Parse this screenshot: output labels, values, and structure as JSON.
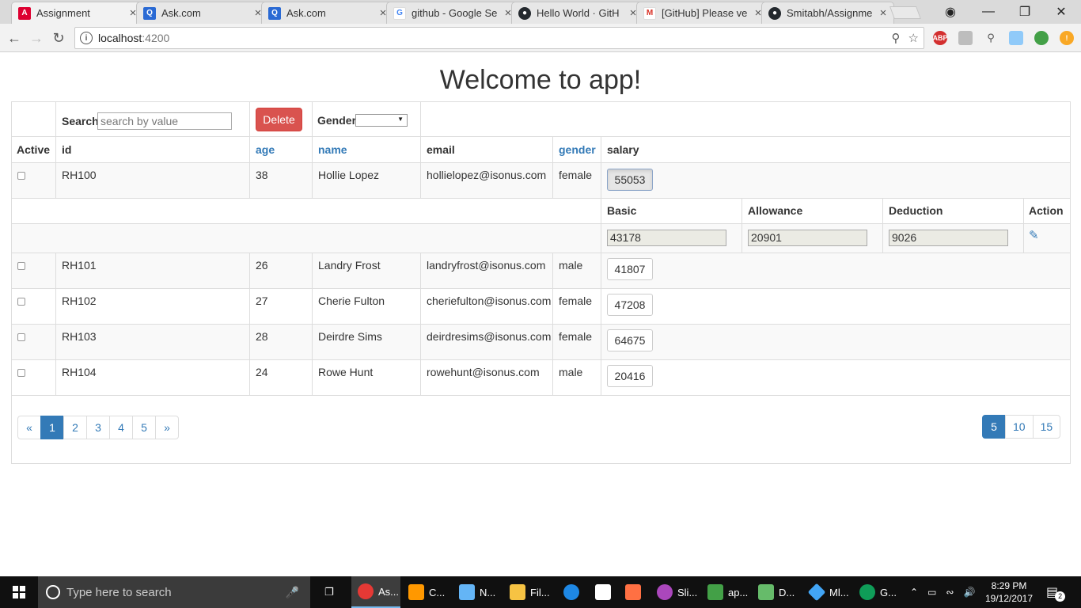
{
  "browser": {
    "tabs": [
      {
        "title": "Assignment",
        "icon": "angular-icon",
        "color": "#dd0031",
        "active": true
      },
      {
        "title": "Ask.com",
        "icon": "ask-icon",
        "color": "#2a6ad4",
        "active": false
      },
      {
        "title": "Ask.com",
        "icon": "ask-icon",
        "color": "#2a6ad4",
        "active": false
      },
      {
        "title": "github - Google Se",
        "icon": "google-icon",
        "color": "#4285f4",
        "active": false
      },
      {
        "title": "Hello World · GitH",
        "icon": "github-icon",
        "color": "#24292e",
        "active": false
      },
      {
        "title": "[GitHub] Please ve",
        "icon": "gmail-icon",
        "color": "#d93025",
        "active": false
      },
      {
        "title": "Smitabh/Assignme",
        "icon": "github-icon",
        "color": "#24292e",
        "active": false
      }
    ],
    "url_host": "localhost",
    "url_port": ":4200",
    "extensions": [
      "ABP"
    ]
  },
  "page": {
    "title": "Welcome to app!",
    "search_label": "Search",
    "search_placeholder": "search by value",
    "delete_label": "Delete",
    "gender_label": "Gender",
    "columns": [
      "Active",
      "id",
      "age",
      "name",
      "email",
      "gender",
      "salary"
    ],
    "rows": [
      {
        "id": "RH100",
        "age": "38",
        "name": "Hollie Lopez",
        "email": "hollielopez@isonus.com",
        "gender": "female",
        "salary": "55053"
      },
      {
        "id": "RH101",
        "age": "26",
        "name": "Landry Frost",
        "email": "landryfrost@isonus.com",
        "gender": "male",
        "salary": "41807"
      },
      {
        "id": "RH102",
        "age": "27",
        "name": "Cherie Fulton",
        "email": "cheriefulton@isonus.com",
        "gender": "female",
        "salary": "47208"
      },
      {
        "id": "RH103",
        "age": "28",
        "name": "Deirdre Sims",
        "email": "deirdresims@isonus.com",
        "gender": "female",
        "salary": "64675"
      },
      {
        "id": "RH104",
        "age": "24",
        "name": "Rowe Hunt",
        "email": "rowehunt@isonus.com",
        "gender": "male",
        "salary": "20416"
      }
    ],
    "detail": {
      "headers": [
        "Basic",
        "Allowance",
        "Deduction",
        "Action"
      ],
      "values": {
        "basic": "43178",
        "allowance": "20901",
        "deduction": "9026"
      }
    },
    "pagination": {
      "prev": "«",
      "pages": [
        "1",
        "2",
        "3",
        "4",
        "5"
      ],
      "next": "»",
      "current": "1"
    },
    "page_sizes": {
      "options": [
        "5",
        "10",
        "15"
      ],
      "current": "5"
    }
  },
  "taskbar": {
    "search_placeholder": "Type here to search",
    "apps": [
      {
        "label": "As...",
        "icon": "chrome-icon",
        "color": "#e53935"
      },
      {
        "label": "C...",
        "icon": "sublime-icon",
        "color": "#ff9800"
      },
      {
        "label": "N...",
        "icon": "notepad-icon",
        "color": "#64b5f6"
      },
      {
        "label": "Fil...",
        "icon": "folder-icon",
        "color": "#f6c343"
      },
      {
        "label": "",
        "icon": "edge-icon",
        "color": "#1e88e5"
      },
      {
        "label": "",
        "icon": "store-icon",
        "color": "#ffffff"
      },
      {
        "label": "",
        "icon": "media-icon",
        "color": "#ff7043"
      },
      {
        "label": "Sli...",
        "icon": "slides-icon",
        "color": "#ab47bc"
      },
      {
        "label": "ap...",
        "icon": "vscode-icon",
        "color": "#43a047"
      },
      {
        "label": "D...",
        "icon": "chart-icon",
        "color": "#66bb6a"
      },
      {
        "label": "Ml...",
        "icon": "diamond-icon",
        "color": "#42a5f5"
      },
      {
        "label": "G...",
        "icon": "hangouts-icon",
        "color": "#0f9d58"
      }
    ],
    "time": "8:29 PM",
    "date": "19/12/2017",
    "notification_count": "2"
  }
}
